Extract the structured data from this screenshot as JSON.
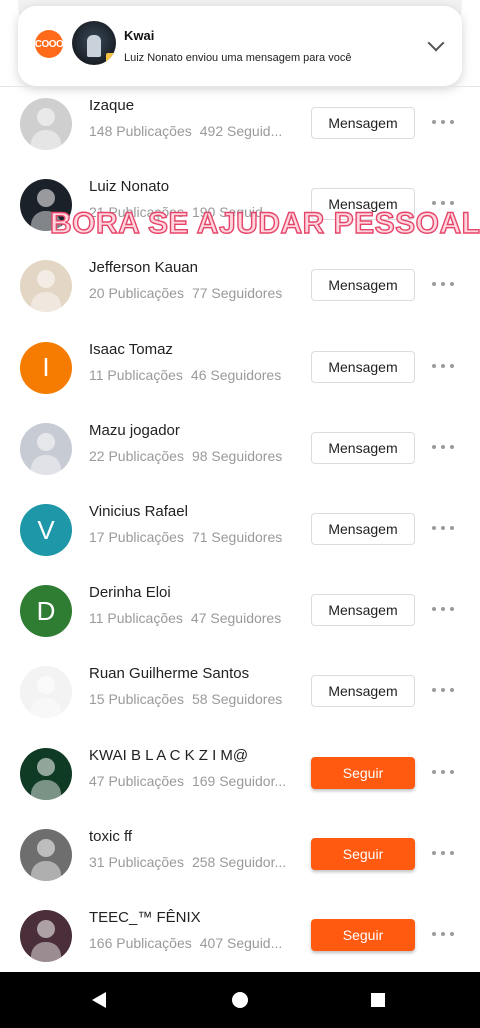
{
  "notification": {
    "app_name": "Kwai",
    "message": "Luiz Nonato enviou uma mensagem para você",
    "app_icon_text": "COOO"
  },
  "overlay": {
    "text": "BORA SE AJUDAR PESSOAL"
  },
  "users": [
    {
      "name": "Izaque",
      "posts": "148 Publicações",
      "followers": "492 Seguid...",
      "action": "Mensagem",
      "action_type": "message",
      "avatar_letter": "",
      "avatar_color": "#cfcfcf"
    },
    {
      "name": "Luiz Nonato",
      "posts": "21 Publicações",
      "followers": "190 Seguid...",
      "action": "Mensagem",
      "action_type": "message",
      "avatar_letter": "",
      "avatar_color": "#1b2129"
    },
    {
      "name": "Jefferson Kauan",
      "posts": "20 Publicações",
      "followers": "77 Seguidores",
      "action": "Mensagem",
      "action_type": "message",
      "avatar_letter": "",
      "avatar_color": "#e4d6c4"
    },
    {
      "name": "Isaac Tomaz",
      "posts": "11 Publicações",
      "followers": "46 Seguidores",
      "action": "Mensagem",
      "action_type": "message",
      "avatar_letter": "I",
      "avatar_color": "#f57c00"
    },
    {
      "name": "Mazu jogador",
      "posts": "22 Publicações",
      "followers": "98 Seguidores",
      "action": "Mensagem",
      "action_type": "message",
      "avatar_letter": "",
      "avatar_color": "#c7cbd3"
    },
    {
      "name": "Vinicius Rafael",
      "posts": "17 Publicações",
      "followers": "71 Seguidores",
      "action": "Mensagem",
      "action_type": "message",
      "avatar_letter": "V",
      "avatar_color": "#1e97a8"
    },
    {
      "name": "Derinha Eloi",
      "posts": "11 Publicações",
      "followers": "47 Seguidores",
      "action": "Mensagem",
      "action_type": "message",
      "avatar_letter": "D",
      "avatar_color": "#2e7d32"
    },
    {
      "name": "Ruan Guilherme Santos",
      "posts": "15 Publicações",
      "followers": "58 Seguidores",
      "action": "Mensagem",
      "action_type": "message",
      "avatar_letter": "",
      "avatar_color": "#f3f3f3"
    },
    {
      "name": "KWAI B L A C K   Z I M@",
      "posts": "47 Publicações",
      "followers": "169 Seguidor...",
      "action": "Seguir",
      "action_type": "follow",
      "avatar_letter": "",
      "avatar_color": "#0f3a24"
    },
    {
      "name": "toxic ff",
      "posts": "31 Publicações",
      "followers": "258 Seguidor...",
      "action": "Seguir",
      "action_type": "follow",
      "avatar_letter": "",
      "avatar_color": "#6e6e6e"
    },
    {
      "name": "TEEC_™ FÊNIX",
      "posts": "166 Publicações",
      "followers": "407 Seguid...",
      "action": "Seguir",
      "action_type": "follow",
      "avatar_letter": "",
      "avatar_color": "#4a2f3a"
    }
  ],
  "colors": {
    "accent": "#ff5a10",
    "muted_text": "#9a9a9a"
  }
}
